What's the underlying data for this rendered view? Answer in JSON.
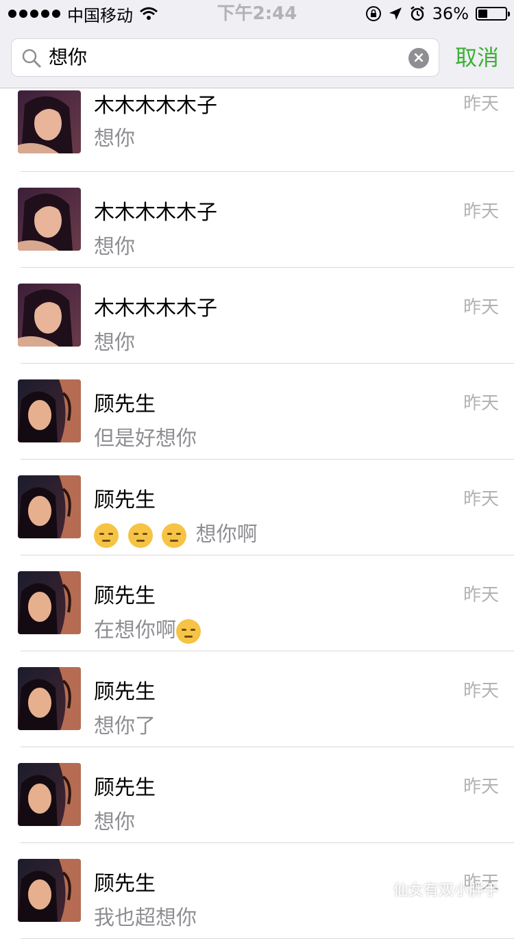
{
  "status": {
    "carrier": "中国移动",
    "time": "下午2:44",
    "battery": "36%"
  },
  "search": {
    "value": "想你",
    "cancel_label": "取消"
  },
  "rows": [
    {
      "name": "木木木木木子",
      "message": "想你",
      "time": "昨天",
      "avatar": "avatar-a"
    },
    {
      "name": "木木木木木子",
      "message": "想你",
      "time": "昨天",
      "avatar": "avatar-a"
    },
    {
      "name": "木木木木木子",
      "message": "想你",
      "time": "昨天",
      "avatar": "avatar-a"
    },
    {
      "name": "顾先生",
      "message": "但是好想你",
      "time": "昨天",
      "avatar": "avatar-b"
    },
    {
      "name": "顾先生",
      "message": "想你啊",
      "emoji_prefix": 3,
      "time": "昨天",
      "avatar": "avatar-b"
    },
    {
      "name": "顾先生",
      "message": "在想你啊",
      "emoji_suffix": 1,
      "time": "昨天",
      "avatar": "avatar-b"
    },
    {
      "name": "顾先生",
      "message": "想你了",
      "time": "昨天",
      "avatar": "avatar-b"
    },
    {
      "name": "顾先生",
      "message": "想你",
      "time": "昨天",
      "avatar": "avatar-b"
    },
    {
      "name": "顾先生",
      "message": "我也超想你",
      "time": "昨天",
      "avatar": "avatar-b"
    }
  ],
  "watermark": "仙女有双小胖手",
  "colors": {
    "accent": "#3cb034",
    "secondary_text": "#8e8e93",
    "bar_bg": "#efeff4"
  }
}
